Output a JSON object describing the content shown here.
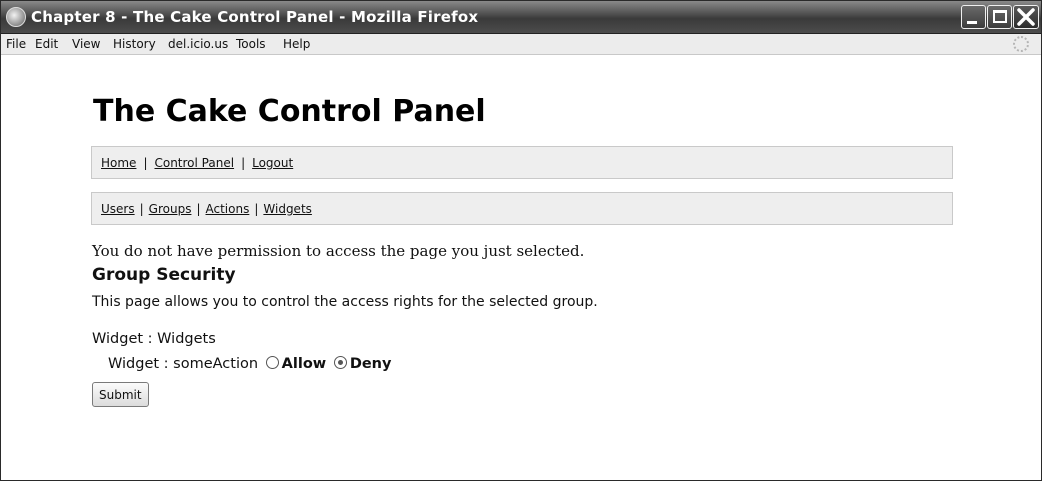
{
  "window": {
    "title": "Chapter 8 - The Cake Control Panel - Mozilla Firefox"
  },
  "menubar": {
    "items": [
      "File",
      "Edit",
      "View",
      "History",
      "del.icio.us",
      "Tools",
      "Help"
    ]
  },
  "page": {
    "site_title": "The Cake Control Panel",
    "main_nav": [
      "Home",
      "Control Panel",
      "Logout"
    ],
    "nav_separator": "|",
    "admin_nav": [
      "Users",
      "Groups",
      "Actions",
      "Widgets"
    ],
    "permission_message": "You do not have permission to access the page you just selected.",
    "section_title": "Group Security",
    "section_description": "This page allows you to control the access rights for the selected group.",
    "group_line": "Widget : Widgets",
    "action_label": "Widget : someAction",
    "options": [
      {
        "label": "Allow",
        "selected": false
      },
      {
        "label": "Deny",
        "selected": true
      }
    ],
    "submit_label": "Submit"
  }
}
